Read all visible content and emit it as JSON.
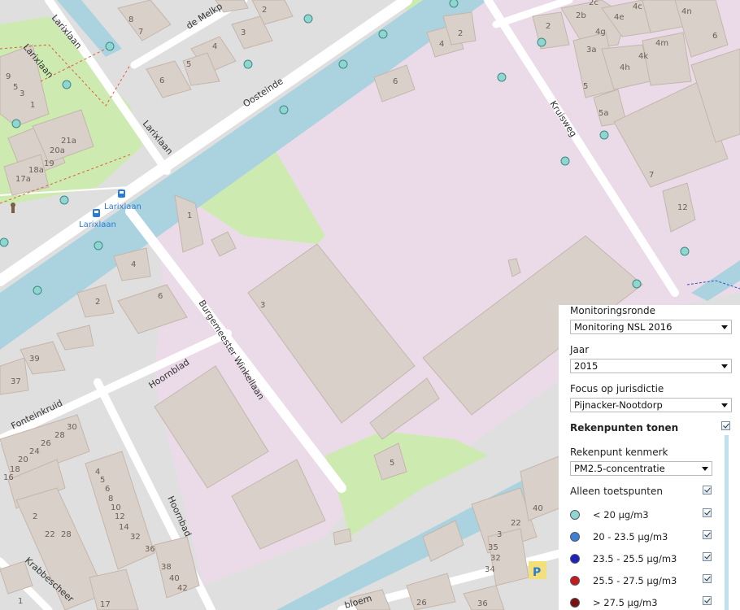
{
  "map": {
    "streets": {
      "larixlaan_1": "Larixlaan",
      "larixlaan_2": "Larixlaan",
      "larixlaan_3": "Larixlaan",
      "melkpad": "de Melkp",
      "oosteinde": "Oosteinde",
      "kruisweg": "Kruisweg",
      "burgemeester": "Burgemeester Winkellaan",
      "hoornblad": "Hoornblad",
      "fonteinkruid": "Fonteinkruid",
      "hoornbad": "Hoornbad",
      "krabbescheer": "Krabbescheer",
      "bloem": "bloem"
    },
    "bus_stops": {
      "stop_1": "Larixlaan",
      "stop_2": "Larixlaan"
    },
    "house_numbers": {
      "h8": "8",
      "h7": "7",
      "h5a": "5",
      "h4a": "4",
      "h3a": "3",
      "h6a": "6",
      "h2a": "2",
      "h9": "9",
      "h5b": "5",
      "h3b": "3",
      "h1": "1",
      "h21a": "21a",
      "h20a": "20a",
      "h19": "19",
      "h18a": "18a",
      "h17a": "17a",
      "h4b": "4",
      "h2b": "2",
      "h6b": "6",
      "h1b": "1",
      "h39": "39",
      "h37": "37",
      "h2c": "2",
      "h4c": "4",
      "h6c": "6",
      "h5c": "5",
      "h2b2": "2b",
      "h2c2": "2c",
      "h4e": "4e",
      "h4c2": "4c",
      "h4n": "4n",
      "h4g": "4g",
      "h3a2": "3a",
      "h4h": "4h",
      "h4k": "4k",
      "h4m": "4m",
      "h6d": "6",
      "h2d": "2",
      "h5d": "5",
      "h5a2": "5a",
      "h7b": "7",
      "h12": "12",
      "h3c": "3",
      "h5e": "5",
      "h30": "30",
      "h28": "28",
      "h26": "26",
      "h24": "24",
      "h22": "22",
      "h20": "20",
      "h18": "18",
      "h16": "16",
      "h4d": "4",
      "h5f": "5",
      "h6e": "6",
      "h8b": "8",
      "h10": "10",
      "h12b": "12",
      "h14": "14",
      "h22b": "22",
      "h28b": "28",
      "h32": "32",
      "h36": "36",
      "h38": "38",
      "h40": "40",
      "h42": "42",
      "h2e": "2",
      "h1c": "1",
      "h3d": "3",
      "h17": "17",
      "h35": "35",
      "h32b": "32",
      "h34": "34",
      "h22c": "22",
      "h26b": "26",
      "h36b": "36",
      "h40b": "40"
    }
  },
  "panel": {
    "monitoringronde_label": "Monitoringsronde",
    "monitoringronde_value": "Monitoring NSL 2016",
    "jaar_label": "Jaar",
    "jaar_value": "2015",
    "focus_label": "Focus op jurisdictie",
    "focus_value": "Pijnacker-Nootdorp",
    "rekenpunten_label": "Rekenpunten tonen",
    "kenmerk_label": "Rekenpunt kenmerk",
    "kenmerk_value": "PM2.5-concentratie",
    "toetspunten_label": "Alleen toetspunten",
    "classes": [
      {
        "label": "< 20 µg/m3",
        "color": "#8fd6d0"
      },
      {
        "label": "20 - 23.5 µg/m3",
        "color": "#3f7fd6"
      },
      {
        "label": "23.5 - 25.5 µg/m3",
        "color": "#1f22b8"
      },
      {
        "label": "25.5 - 27.5 µg/m3",
        "color": "#c41a1a"
      },
      {
        "label": "> 27.5 µg/m3",
        "color": "#7a1010"
      }
    ]
  },
  "colors": {
    "land": "#e0dfdf",
    "industrial": "#ebdbe8",
    "park": "#cdebb0",
    "water": "#aad3df",
    "building": "#d9d0c9",
    "building_stroke": "#c4b6ab",
    "road": "#ffffff",
    "point": "#8fd6d0"
  }
}
